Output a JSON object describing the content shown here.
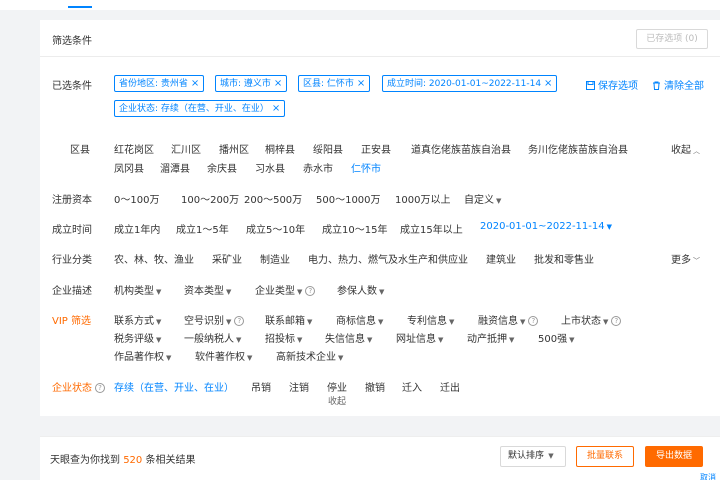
{
  "panel": {
    "title": "筛选条件",
    "saved_options_label": "已存选项 (0)"
  },
  "selected": {
    "label": "已选条件",
    "chips": [
      "省份地区: 贵州省",
      "城市: 遵义市",
      "区县: 仁怀市",
      "成立时间: 2020-01-01~2022-11-14",
      "企业状态: 存续（在营、开业、在业）"
    ],
    "save_label": "保存选项",
    "clear_label": "清除全部"
  },
  "district": {
    "label": "区县",
    "options": [
      "红花岗区",
      "汇川区",
      "播州区",
      "桐梓县",
      "绥阳县",
      "正安县",
      "道真仡佬族苗族自治县",
      "务川仡佬族苗族自治县",
      "凤冈县",
      "湄潭县",
      "余庆县",
      "习水县",
      "赤水市",
      "仁怀市"
    ],
    "selected": "仁怀市",
    "collapse_label": "收起"
  },
  "capital": {
    "label": "注册资本",
    "options": [
      "0～100万",
      "100～200万",
      "200～500万",
      "500～1000万",
      "1000万以上",
      "自定义"
    ]
  },
  "founded": {
    "label": "成立时间",
    "options": [
      "成立1年内",
      "成立1～5年",
      "成立5～10年",
      "成立10～15年",
      "成立15年以上"
    ],
    "selected_range": "2020-01-01~2022-11-14"
  },
  "industry": {
    "label": "行业分类",
    "options": [
      "农、林、牧、渔业",
      "采矿业",
      "制造业",
      "电力、热力、燃气及水生产和供应业",
      "建筑业",
      "批发和零售业"
    ],
    "more_label": "更多"
  },
  "description": {
    "label": "企业描述",
    "options": [
      "机构类型",
      "资本类型",
      "企业类型",
      "参保人数"
    ]
  },
  "vip": {
    "label": "VIP 筛选",
    "row1": [
      "联系方式",
      "空号识别",
      "联系邮箱",
      "商标信息",
      "专利信息",
      "融资信息",
      "上市状态"
    ],
    "row2": [
      "税务评级",
      "一般纳税人",
      "招投标",
      "失信信息",
      "网址信息",
      "动产抵押",
      "500强"
    ],
    "row3": [
      "作品著作权",
      "软件著作权",
      "高新技术企业"
    ]
  },
  "status": {
    "label": "企业状态",
    "options": [
      "存续（在营、开业、在业）",
      "吊销",
      "注销",
      "停业",
      "撤销",
      "迁入",
      "迁出"
    ],
    "selected": "存续（在营、开业、在业）"
  },
  "collapse_tab_label": "收起",
  "results": {
    "prefix": "天眼查为你找到",
    "count": "520",
    "suffix": "条相关结果",
    "sort_label": "默认排序",
    "bulk_contact_label": "批量联系",
    "export_label": "导出数据",
    "corner_text": "取消"
  },
  "colors": {
    "accent": "#0084ff",
    "orange": "#ff6a00"
  }
}
